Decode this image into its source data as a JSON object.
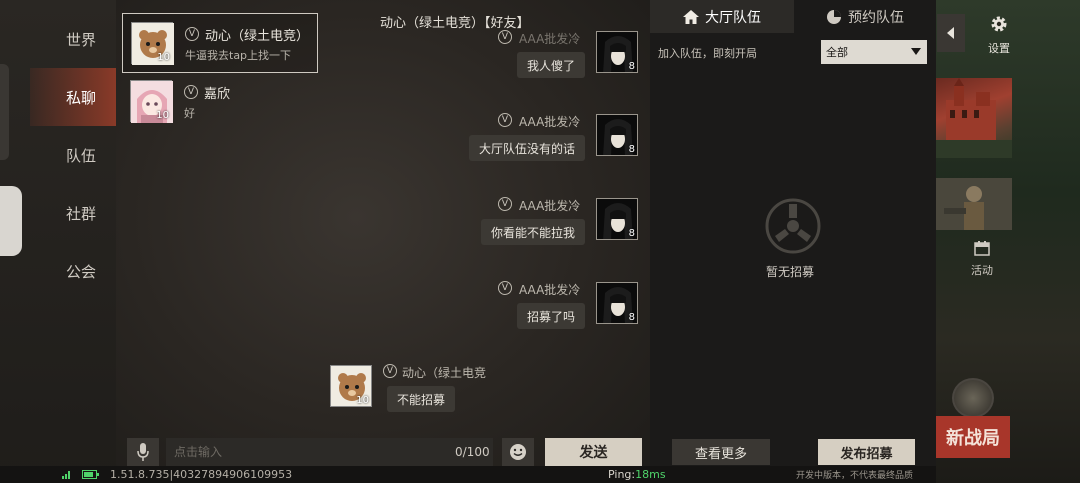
{
  "nav": {
    "items": [
      {
        "label": "世界"
      },
      {
        "label": "私聊"
      },
      {
        "label": "队伍"
      },
      {
        "label": "社群"
      },
      {
        "label": "公会"
      }
    ],
    "active_index": 1
  },
  "conversations": [
    {
      "name": "动心（绿土电竞）",
      "last_message": "牛逼我去tap上找一下",
      "vip": "V",
      "level": "10",
      "selected": true
    },
    {
      "name": "嘉欣",
      "last_message": "好",
      "vip": "V",
      "level": "10",
      "selected": false
    }
  ],
  "chat": {
    "title": "动心（绿土电竞）【好友】",
    "messages": [
      {
        "sender": "AAA批发冷",
        "text": "我人傻了",
        "level": "8",
        "side": "right"
      },
      {
        "sender": "AAA批发冷",
        "text": "大厅队伍没有的话",
        "level": "8",
        "side": "right"
      },
      {
        "sender": "AAA批发冷",
        "text": "你看能不能拉我",
        "level": "8",
        "side": "right"
      },
      {
        "sender": "AAA批发冷",
        "text": "招募了吗",
        "level": "8",
        "side": "right"
      },
      {
        "sender": "动心（绿土电竞",
        "text": "不能招募",
        "level": "10",
        "side": "left"
      }
    ],
    "vip": "V",
    "input_placeholder": "点击输入",
    "counter": "0/100",
    "send_label": "发送"
  },
  "status": {
    "version": "1.51.8.735|40327894906109953",
    "ping_label": "Ping:",
    "ping_value": "18ms",
    "beta_note": "开发中版本，不代表最终品质"
  },
  "team_panel": {
    "tabs": [
      {
        "label": "大厅队伍",
        "icon": "home-icon"
      },
      {
        "label": "预约队伍",
        "icon": "pie-clock-icon"
      }
    ],
    "join_label": "加入队伍，即刻开局",
    "filter_value": "全部",
    "empty_text": "暂无招募",
    "more_label": "查看更多",
    "publish_label": "发布招募"
  },
  "right_panel": {
    "settings_label": "设置",
    "activity_label": "活动",
    "new_battle_label": "新战局"
  },
  "colors": {
    "accent_red": "#a8362a",
    "nav_active": "#8a3a28",
    "ping_green": "#4fd36a"
  }
}
